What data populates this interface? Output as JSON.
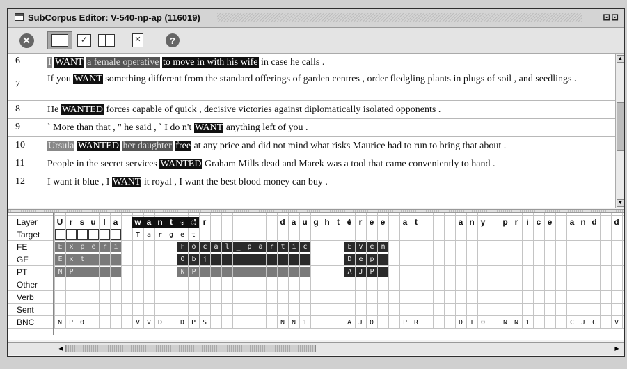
{
  "window": {
    "title": "SubCorpus Editor: V-540-np-ap (116019)",
    "controls": "⊡⊡"
  },
  "toolbar": {
    "buttons": [
      {
        "name": "close-button",
        "icon": "close-circle-icon",
        "glyph": "✕"
      },
      {
        "name": "single-view-button",
        "icon": "single-pane-icon",
        "glyph": ""
      },
      {
        "name": "check-view-button",
        "icon": "checkmark-icon",
        "glyph": "✓"
      },
      {
        "name": "split-view-button",
        "icon": "split-pane-icon",
        "glyph": ""
      },
      {
        "name": "document-button",
        "icon": "document-x-icon",
        "glyph": "✕"
      },
      {
        "name": "help-button",
        "icon": "help-icon",
        "glyph": "?"
      }
    ]
  },
  "sentences": [
    {
      "num": "6",
      "segments": [
        {
          "t": "I",
          "s": "lgrey"
        },
        {
          "t": " "
        },
        {
          "t": "WANT",
          "s": "black"
        },
        {
          "t": " "
        },
        {
          "t": "a female operative",
          "s": "grey"
        },
        {
          "t": " "
        },
        {
          "t": "to move in with his wife",
          "s": "black"
        },
        {
          "t": " in case he calls ."
        }
      ]
    },
    {
      "num": "7",
      "segments": [
        {
          "t": "If you "
        },
        {
          "t": "WANT",
          "s": "black"
        },
        {
          "t": " something different from the standard offerings of garden centres , order fledgling plants in plugs of soil , and seedlings ."
        }
      ]
    },
    {
      "num": "8",
      "segments": [
        {
          "t": "He "
        },
        {
          "t": "WANTED",
          "s": "black"
        },
        {
          "t": " forces capable of quick , decisive victories against diplomatically isolated opponents ."
        }
      ]
    },
    {
      "num": "9",
      "segments": [
        {
          "t": "` More than that , \" he said , ` I do n't "
        },
        {
          "t": "WANT",
          "s": "black"
        },
        {
          "t": " anything left of you ."
        }
      ]
    },
    {
      "num": "10",
      "segments": [
        {
          "t": "Ursula",
          "s": "lgrey"
        },
        {
          "t": " "
        },
        {
          "t": "WANTED",
          "s": "black"
        },
        {
          "t": " "
        },
        {
          "t": "her daughter",
          "s": "grey"
        },
        {
          "t": " "
        },
        {
          "t": "free",
          "s": "black"
        },
        {
          "t": " at any price and did not mind what risks Maurice had to run to bring that about ."
        }
      ]
    },
    {
      "num": "11",
      "segments": [
        {
          "t": "People in the secret services "
        },
        {
          "t": "WANTED",
          "s": "black"
        },
        {
          "t": " Graham Mills dead and Marek was a tool that came conveniently to hand ."
        }
      ]
    },
    {
      "num": "12",
      "segments": [
        {
          "t": "I want it blue , I "
        },
        {
          "t": "WANT",
          "s": "black"
        },
        {
          "t": " it royal , I want the best blood money can buy ."
        }
      ]
    }
  ],
  "annotation": {
    "layers": [
      "Layer",
      "Target",
      "FE",
      "GF",
      "PT",
      "Other",
      "Verb",
      "Sent",
      "BNC"
    ],
    "words": [
      {
        "text": "Ursula",
        "target": false
      },
      {
        "text": "wanted",
        "target": true
      },
      {
        "text": "her",
        "target": false
      },
      {
        "text": "daughter",
        "target": false
      },
      {
        "text": "free",
        "target": false
      },
      {
        "text": "at",
        "target": false
      },
      {
        "text": "any",
        "target": false
      },
      {
        "text": "price",
        "target": false
      },
      {
        "text": "and",
        "target": false
      },
      {
        "text": "d",
        "target": false
      }
    ],
    "target_label": "Target",
    "fe": [
      {
        "label": "Experi",
        "tone": "mid"
      },
      {
        "label": "Focal_partic",
        "tone": "dark"
      },
      {
        "label": "Even",
        "tone": "dark"
      }
    ],
    "gf": [
      {
        "label": "Ext",
        "tone": "mid"
      },
      {
        "label": "Obj",
        "tone": "dark"
      },
      {
        "label": "Dep",
        "tone": "dark"
      }
    ],
    "pt": [
      {
        "label": "NP",
        "tone": "mid"
      },
      {
        "label": "NP",
        "tone": "mid"
      },
      {
        "label": "AJP",
        "tone": "dark"
      }
    ],
    "bnc": [
      "NP0",
      "VVD",
      "DPS",
      "NN1",
      "AJ0",
      "PR",
      "DT0",
      "NN1",
      "CJC",
      "V"
    ]
  }
}
